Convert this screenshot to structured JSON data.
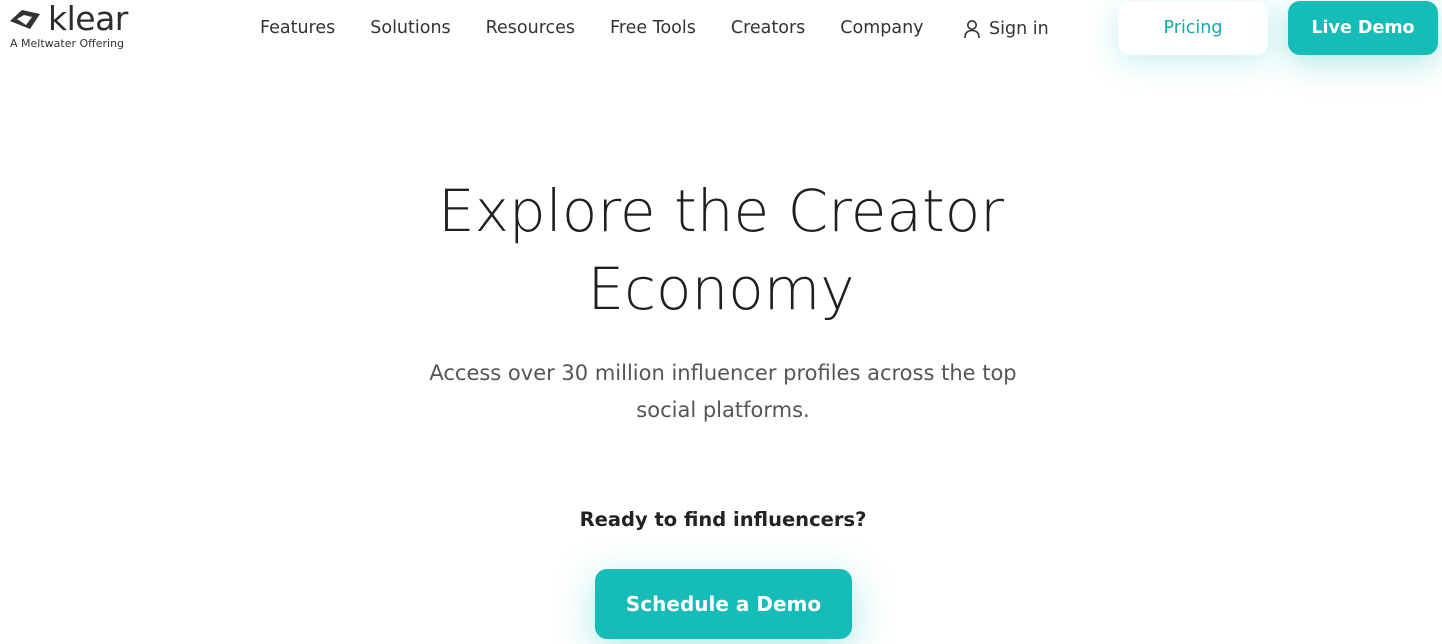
{
  "brand": {
    "name": "klear",
    "tagline": "A Meltwater Offering",
    "accent_color": "#16bcb8"
  },
  "nav": {
    "items": [
      {
        "label": "Features"
      },
      {
        "label": "Solutions"
      },
      {
        "label": "Resources"
      },
      {
        "label": "Free Tools"
      },
      {
        "label": "Creators"
      },
      {
        "label": "Company"
      }
    ],
    "sign_in": {
      "label": "Sign in",
      "icon": "user-icon"
    },
    "pricing_label": "Pricing",
    "live_demo_label": "Live Demo"
  },
  "hero": {
    "title_line1": "Explore the Creator",
    "title_line2": "Economy",
    "subtitle": "Access over 30 million influencer profiles across the top social platforms.",
    "cta_prompt": "Ready to find influencers?",
    "cta_button": "Schedule a Demo"
  }
}
